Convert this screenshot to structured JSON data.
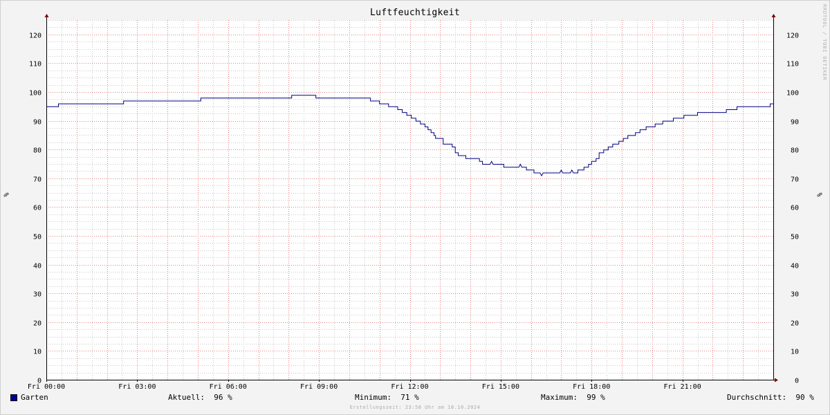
{
  "chart_data": {
    "type": "line",
    "title": "Luftfeuchtigkeit",
    "ylabel": "%",
    "ylim": [
      0,
      125
    ],
    "yticks": [
      0,
      10,
      20,
      30,
      40,
      50,
      60,
      70,
      80,
      90,
      100,
      110,
      120
    ],
    "xlim": [
      0,
      24
    ],
    "xticks": [
      {
        "x": 0,
        "label": "Fri 00:00"
      },
      {
        "x": 3,
        "label": "Fri 03:00"
      },
      {
        "x": 6,
        "label": "Fri 06:00"
      },
      {
        "x": 9,
        "label": "Fri 09:00"
      },
      {
        "x": 12,
        "label": "Fri 12:00"
      },
      {
        "x": 15,
        "label": "Fri 15:00"
      },
      {
        "x": 18,
        "label": "Fri 18:00"
      },
      {
        "x": 21,
        "label": "Fri 21:00"
      }
    ],
    "grid": true,
    "series": [
      {
        "name": "Garten",
        "color": "#000080",
        "points": [
          [
            0.0,
            95
          ],
          [
            0.4,
            95
          ],
          [
            0.4,
            96
          ],
          [
            2.55,
            96
          ],
          [
            2.55,
            97
          ],
          [
            5.1,
            97
          ],
          [
            5.1,
            98
          ],
          [
            8.1,
            98
          ],
          [
            8.1,
            99
          ],
          [
            8.9,
            99
          ],
          [
            8.9,
            98
          ],
          [
            10.7,
            98
          ],
          [
            10.7,
            97
          ],
          [
            11.0,
            97
          ],
          [
            11.0,
            96
          ],
          [
            11.3,
            96
          ],
          [
            11.3,
            95
          ],
          [
            11.6,
            95
          ],
          [
            11.6,
            94
          ],
          [
            11.75,
            94
          ],
          [
            11.75,
            93
          ],
          [
            11.9,
            93
          ],
          [
            11.9,
            92
          ],
          [
            12.05,
            92
          ],
          [
            12.05,
            91
          ],
          [
            12.2,
            91
          ],
          [
            12.2,
            90
          ],
          [
            12.35,
            90
          ],
          [
            12.35,
            89
          ],
          [
            12.5,
            89
          ],
          [
            12.5,
            88
          ],
          [
            12.6,
            88
          ],
          [
            12.6,
            87
          ],
          [
            12.7,
            87
          ],
          [
            12.7,
            86
          ],
          [
            12.8,
            86
          ],
          [
            12.8,
            85
          ],
          [
            12.85,
            85
          ],
          [
            12.85,
            84
          ],
          [
            13.1,
            84
          ],
          [
            13.1,
            82
          ],
          [
            13.4,
            82
          ],
          [
            13.4,
            81
          ],
          [
            13.5,
            81
          ],
          [
            13.5,
            79
          ],
          [
            13.6,
            79
          ],
          [
            13.6,
            78
          ],
          [
            13.85,
            78
          ],
          [
            13.85,
            77
          ],
          [
            14.3,
            77
          ],
          [
            14.3,
            76
          ],
          [
            14.4,
            76
          ],
          [
            14.4,
            75
          ],
          [
            14.65,
            75
          ],
          [
            14.7,
            76
          ],
          [
            14.75,
            75
          ],
          [
            15.1,
            75
          ],
          [
            15.1,
            74
          ],
          [
            15.6,
            74
          ],
          [
            15.65,
            75
          ],
          [
            15.7,
            74
          ],
          [
            15.85,
            74
          ],
          [
            15.85,
            73
          ],
          [
            16.1,
            73
          ],
          [
            16.1,
            72
          ],
          [
            16.3,
            72
          ],
          [
            16.35,
            71
          ],
          [
            16.4,
            72
          ],
          [
            16.95,
            72
          ],
          [
            17.0,
            73
          ],
          [
            17.05,
            72
          ],
          [
            17.3,
            72
          ],
          [
            17.35,
            73
          ],
          [
            17.4,
            72
          ],
          [
            17.55,
            72
          ],
          [
            17.55,
            73
          ],
          [
            17.75,
            73
          ],
          [
            17.75,
            74
          ],
          [
            17.9,
            74
          ],
          [
            17.9,
            75
          ],
          [
            18.0,
            75
          ],
          [
            18.0,
            76
          ],
          [
            18.15,
            76
          ],
          [
            18.15,
            77
          ],
          [
            18.25,
            77
          ],
          [
            18.25,
            79
          ],
          [
            18.4,
            79
          ],
          [
            18.4,
            80
          ],
          [
            18.55,
            80
          ],
          [
            18.55,
            81
          ],
          [
            18.7,
            81
          ],
          [
            18.7,
            82
          ],
          [
            18.9,
            82
          ],
          [
            18.9,
            83
          ],
          [
            19.05,
            83
          ],
          [
            19.05,
            84
          ],
          [
            19.2,
            84
          ],
          [
            19.2,
            85
          ],
          [
            19.45,
            85
          ],
          [
            19.45,
            86
          ],
          [
            19.6,
            86
          ],
          [
            19.6,
            87
          ],
          [
            19.8,
            87
          ],
          [
            19.8,
            88
          ],
          [
            20.1,
            88
          ],
          [
            20.1,
            89
          ],
          [
            20.35,
            89
          ],
          [
            20.35,
            90
          ],
          [
            20.7,
            90
          ],
          [
            20.7,
            91
          ],
          [
            21.05,
            91
          ],
          [
            21.05,
            92
          ],
          [
            21.5,
            92
          ],
          [
            21.5,
            93
          ],
          [
            22.45,
            93
          ],
          [
            22.45,
            94
          ],
          [
            22.8,
            94
          ],
          [
            22.8,
            95
          ],
          [
            23.9,
            95
          ],
          [
            23.9,
            96
          ],
          [
            24.0,
            96
          ]
        ]
      }
    ]
  },
  "legend": {
    "series_name": "Garten",
    "current_label": "Aktuell:",
    "current_value": "96 %",
    "min_label": "Minimum:",
    "min_value": "71 %",
    "max_label": "Maximum:",
    "max_value": "99 %",
    "avg_label": "Durchschnitt:",
    "avg_value": "90 %"
  },
  "watermark": "RRDTOOL / TOBI OETIKER",
  "footer": "Erstellungszeit: 23:58 Uhr am 18.10.2024",
  "colors": {
    "background": "#f3f3f3",
    "plot_background": "#ffffff",
    "line": "#000080",
    "swatch": "#0000a0",
    "major_grid": "#e08080",
    "minor_grid": "#c8c8c8",
    "axis_arrow": "#800000"
  }
}
